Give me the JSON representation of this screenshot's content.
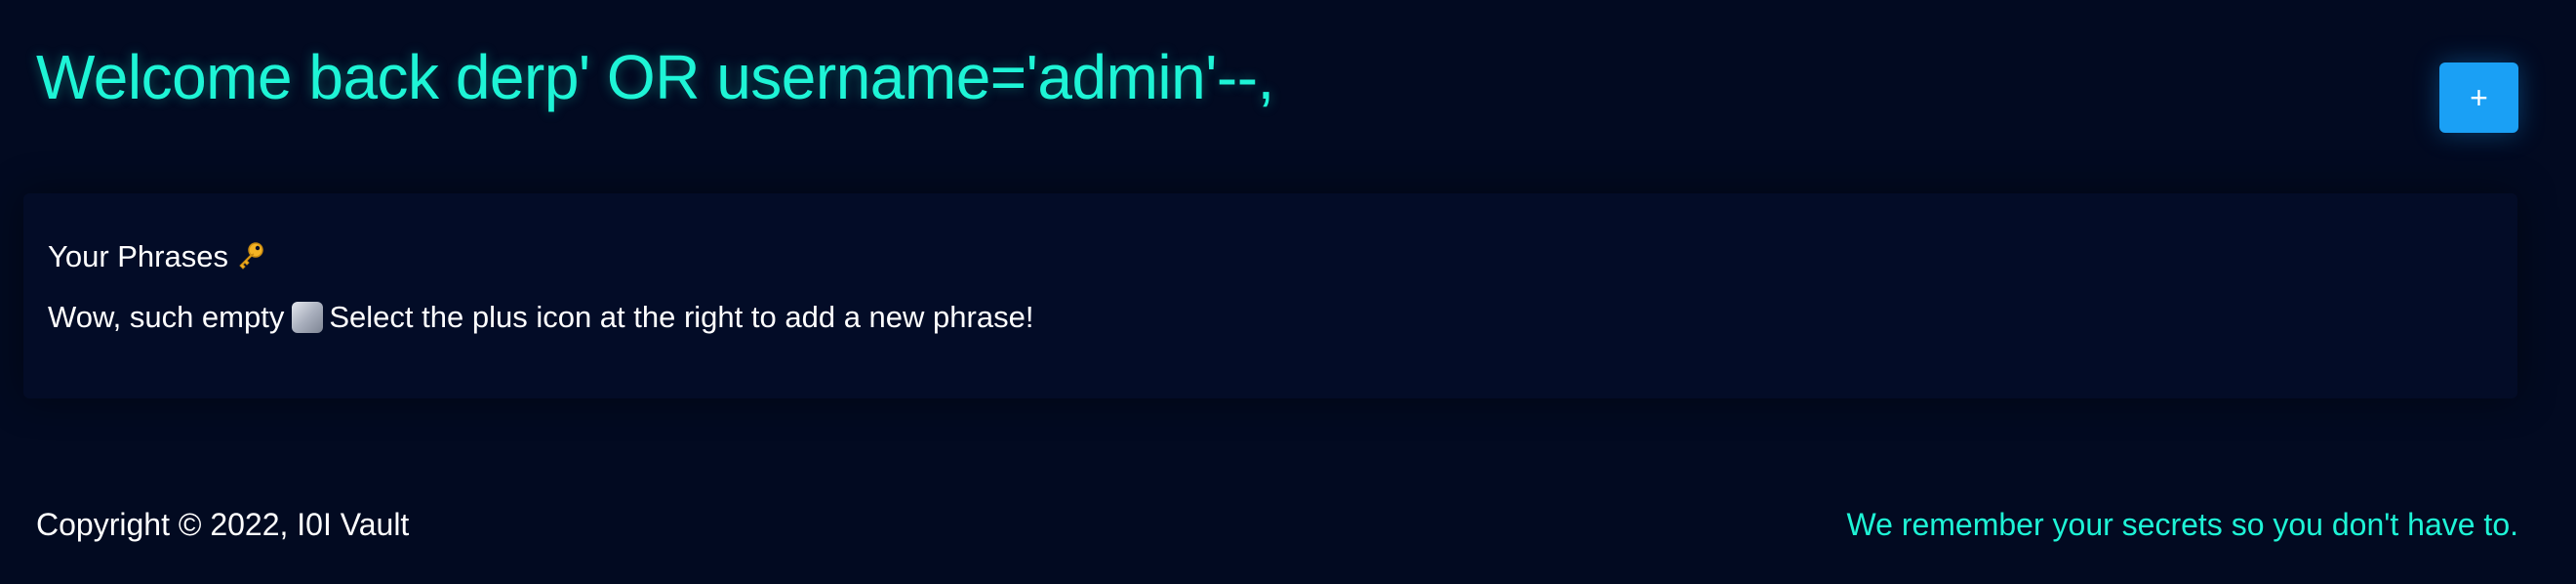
{
  "header": {
    "welcome_text": "Welcome back derp' OR username='admin'--,",
    "add_button_label": "+"
  },
  "phrases": {
    "title": "Your Phrases",
    "empty_message_before": "Wow, such empty",
    "empty_message_after": "Select the plus icon at the right to add a new phrase!"
  },
  "footer": {
    "copyright": "Copyright © 2022, I0I Vault",
    "tagline": "We remember your secrets so you don't have to."
  },
  "icons": {
    "phrases_title_icon": "key-icon",
    "empty_icon": "empty-placeholder-icon"
  },
  "colors": {
    "background": "#020a21",
    "accent": "#1ef4d6",
    "button": "#1aa0f5"
  }
}
